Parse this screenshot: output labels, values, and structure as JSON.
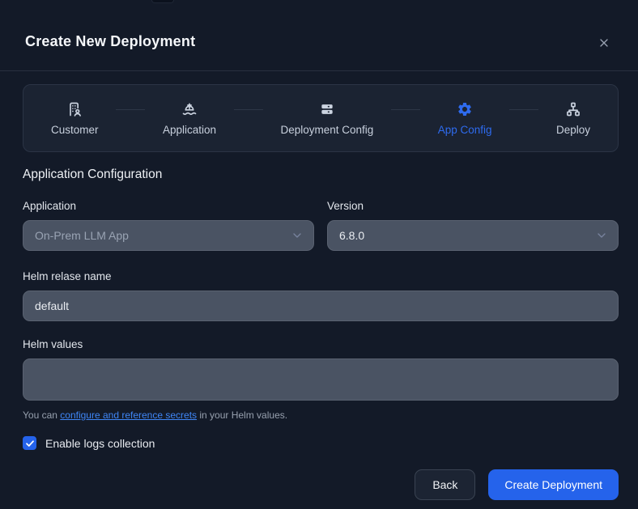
{
  "window": {
    "title": "Create New Deployment"
  },
  "stepper": {
    "steps": [
      {
        "label": "Customer",
        "icon": "building-user-icon",
        "active": false
      },
      {
        "label": "Application",
        "icon": "ship-icon",
        "active": false
      },
      {
        "label": "Deployment Config",
        "icon": "server-icon",
        "active": false
      },
      {
        "label": "App Config",
        "icon": "gear-icon",
        "active": true
      },
      {
        "label": "Deploy",
        "icon": "network-icon",
        "active": false
      }
    ]
  },
  "section": {
    "title": "Application Configuration"
  },
  "form": {
    "application": {
      "label": "Application",
      "value": "On-Prem LLM App",
      "disabled": true
    },
    "version": {
      "label": "Version",
      "value": "6.8.0"
    },
    "helm_release": {
      "label": "Helm relase name",
      "value": "default"
    },
    "helm_values": {
      "label": "Helm values",
      "value": ""
    },
    "secrets_note": {
      "prefix": "You can ",
      "link_text": "configure and reference secrets",
      "suffix": " in your Helm values."
    },
    "logs_collection": {
      "label": "Enable logs collection",
      "checked": true
    }
  },
  "footer": {
    "back_label": "Back",
    "create_label": "Create Deployment"
  },
  "colors": {
    "page_bg": "#131a28",
    "card_bg": "#1b2332",
    "field_bg": "#4a5363",
    "accent_blue": "#2563eb",
    "active_step_blue": "#2e6bef",
    "link_blue": "#3f86f6"
  }
}
